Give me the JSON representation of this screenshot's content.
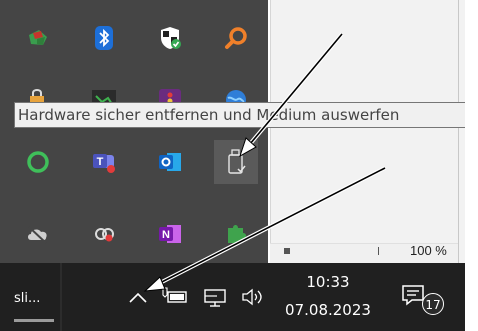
{
  "tooltip": {
    "text": "Hardware sicher entfernen und Medium auswerfen"
  },
  "document": {
    "zoom": "100 %"
  },
  "overflow_icons": [
    "colored-app-icon",
    "bluetooth-icon",
    "windows-security-icon",
    "search-app-icon",
    "vpn-lock-icon",
    "network-app-icon",
    "media-app-icon",
    "globe-app-icon",
    "circle-app-icon",
    "teams-icon",
    "outlook-icon",
    "usb-eject-icon",
    "cloud-offline-icon",
    "creative-cloud-icon",
    "onenote-icon",
    "puzzle-icon"
  ],
  "taskbar": {
    "app_label": "sli...",
    "clock": {
      "time": "10:33",
      "date": "07.08.2023"
    },
    "notification_count": "17"
  },
  "colors": {
    "panel": "#454545",
    "taskbar": "#202020",
    "tooltip_bg": "#f0f0f0"
  }
}
